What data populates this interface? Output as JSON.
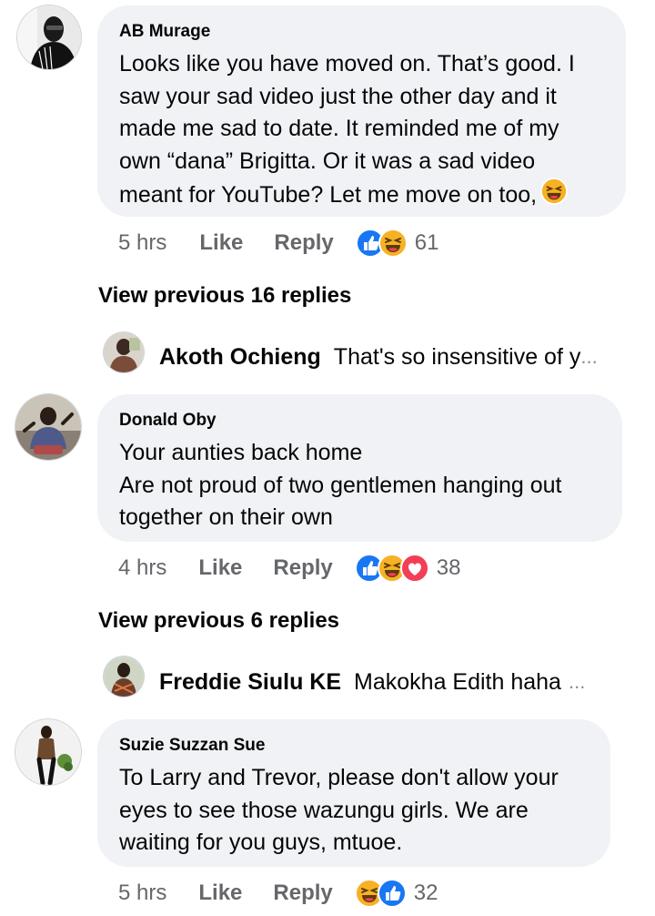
{
  "comments": [
    {
      "author": "AB Murage",
      "text": "Looks like you have moved on. That’s good. I\nsaw your sad video just the other day and it\nmade me sad to date. It reminded me of my\nown “dana” Brigitta. Or it was a sad video\nmeant for YouTube? Let me move on too,",
      "trailing_emoji": "grinning-squinting-face",
      "time": "5 hrs",
      "like_label": "Like",
      "reply_label": "Reply",
      "reactions": [
        "like",
        "haha"
      ],
      "reaction_count": "61",
      "view_previous": "View previous 16 replies",
      "preview_author": "Akoth Ochieng",
      "preview_text": "That's so insensitive of y",
      "preview_ellipsis": "..."
    },
    {
      "author": "Donald Oby",
      "text": "Your aunties back home\nAre not  proud of two gentlemen hanging out\ntogether on their own",
      "time": "4 hrs",
      "like_label": "Like",
      "reply_label": "Reply",
      "reactions": [
        "like",
        "haha",
        "love"
      ],
      "reaction_count": "38",
      "view_previous": "View previous 6 replies",
      "preview_author": "Freddie Siulu KE",
      "preview_text": "Makokha Edith haha",
      "preview_ellipsis": "..."
    },
    {
      "author": "Suzie Suzzan Sue",
      "text": "To Larry and Trevor, please don't allow your\neyes to see those wazungu girls. We are\nwaiting for you guys, mtuoe.",
      "time": "5 hrs",
      "like_label": "Like",
      "reply_label": "Reply",
      "reactions": [
        "haha",
        "like"
      ],
      "reaction_count": "32"
    }
  ],
  "colors": {
    "bubble": "#f0f2f5",
    "text": "#050505",
    "meta": "#65676b",
    "like_blue": "#1877f2",
    "haha_yellow": "#f7b125",
    "love_red": "#f33e58"
  }
}
